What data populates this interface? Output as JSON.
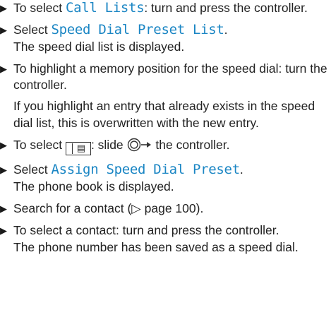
{
  "steps": [
    {
      "parts": [
        {
          "t": "To select "
        },
        {
          "t": "Call Lists",
          "mono": true
        },
        {
          "t": ": turn and press the controller."
        }
      ]
    },
    {
      "parts": [
        {
          "t": "Select "
        },
        {
          "t": "Speed Dial Preset List",
          "mono": true
        },
        {
          "t": "."
        }
      ],
      "result": "The speed dial list is displayed."
    },
    {
      "parts": [
        {
          "t": "To highlight a memory position for the speed dial: turn the controller."
        }
      ],
      "note": "If you highlight an entry that already exists in the speed dial list, this is overwritten with the new entry."
    },
    {
      "parts": [
        {
          "t": "To select "
        },
        {
          "icon": "phonebook-softkey-icon",
          "glyph": "▤"
        },
        {
          "t": ": slide "
        },
        {
          "icon": "controller-slide-right-icon"
        },
        {
          "t": " the controller."
        }
      ]
    },
    {
      "parts": [
        {
          "t": "Select "
        },
        {
          "t": "Assign Speed Dial Preset",
          "mono": true
        },
        {
          "t": "."
        }
      ],
      "result": "The phone book is displayed."
    },
    {
      "parts": [
        {
          "t": "Search for a contact (▷ page 100)."
        }
      ]
    },
    {
      "parts": [
        {
          "t": "To select a contact: turn and press the controller."
        }
      ],
      "result": "The phone number has been saved as a speed dial."
    }
  ],
  "bullet_glyph": "▶",
  "colors": {
    "text": "#222222",
    "menu_item": "#1b86c4"
  }
}
